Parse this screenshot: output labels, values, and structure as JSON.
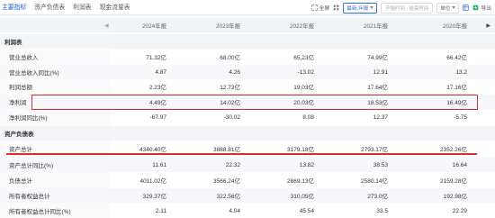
{
  "tabs": [
    {
      "label": "主要指标",
      "active": true
    },
    {
      "label": "资产负债表",
      "active": false
    },
    {
      "label": "利润表",
      "active": false
    },
    {
      "label": "现金流量表",
      "active": false
    }
  ],
  "toolbar": {
    "fullscreen": "全屏",
    "report_type": "最新,年报",
    "start_date": "开始时间 - 结束时间",
    "unit": "单位",
    "export": "导出"
  },
  "header": [
    "2024年报",
    "2023年报",
    "2022年报",
    "2021年报",
    "2020年报"
  ],
  "rows": [
    {
      "type": "section",
      "label": "利润表",
      "values": [
        "",
        "",
        "",
        "",
        ""
      ]
    },
    {
      "type": "data",
      "label": "营业总收入",
      "values": [
        "71.32亿",
        "68.00亿",
        "65.23亿",
        "74.99亿",
        "66.42亿"
      ]
    },
    {
      "type": "data",
      "label": "营业总收入同比(%)",
      "values": [
        "4.87",
        "4.26",
        "-13.02",
        "12.91",
        "13.2"
      ]
    },
    {
      "type": "data",
      "label": "利润总额",
      "values": [
        "2.23亿",
        "12.73亿",
        "19.03亿",
        "17.64亿",
        "17.16亿"
      ]
    },
    {
      "type": "data",
      "label": "净利润",
      "values": [
        "4.49亿",
        "14.02亿",
        "20.03亿",
        "18.53亿",
        "16.49亿"
      ]
    },
    {
      "type": "data",
      "label": "净利润同比(%)",
      "values": [
        "-67.97",
        "-30.02",
        "8.08",
        "12.37",
        "-5.75"
      ]
    },
    {
      "type": "section",
      "label": "资产负债表",
      "values": [
        "",
        "",
        "",
        "",
        ""
      ]
    },
    {
      "type": "data",
      "label": "资产总计",
      "values": [
        "4340.40亿",
        "3888.81亿",
        "3179.18亿",
        "2793.17亿",
        "2352.26亿"
      ]
    },
    {
      "type": "data",
      "label": "资产总计同比(%)",
      "values": [
        "11.61",
        "22.32",
        "13.82",
        "38.53",
        "16.64"
      ]
    },
    {
      "type": "data",
      "label": "负债总计",
      "values": [
        "4011.02亿",
        "3566.24亿",
        "2869.13亿",
        "2580.14亿",
        "2159.28亿"
      ]
    },
    {
      "type": "data",
      "label": "所有者权益总计",
      "values": [
        "329.37亿",
        "322.56亿",
        "310.05亿",
        "273.0亿",
        "192.98亿"
      ]
    },
    {
      "type": "data",
      "label": "所有者权益总计同比(%)",
      "values": [
        "2.11",
        "4.04",
        "45.54",
        "33.5",
        "22.29"
      ]
    }
  ]
}
